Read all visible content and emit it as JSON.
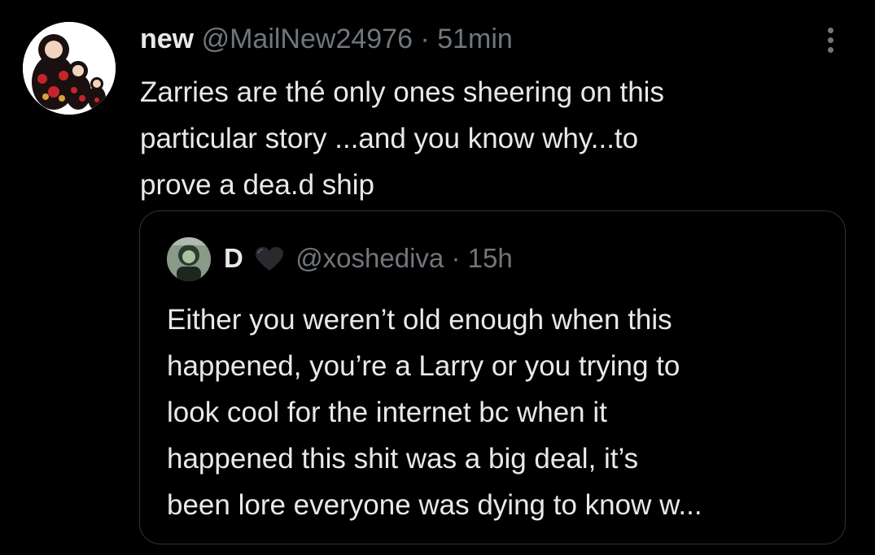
{
  "tweet": {
    "display_name": "new",
    "handle": "@MailNew24976",
    "separator": "·",
    "time": "51min",
    "text": "Zarries are thé only ones sheering on this\nparticular story ...and you know why...to\nprove a dea.d ship",
    "avatar_icon": "matryoshka-dolls-avatar",
    "more_icon": "more-options-icon"
  },
  "quote": {
    "display_name": "D",
    "emoji": "black-heart-icon",
    "handle": "@xoshediva",
    "separator": "·",
    "time": "15h",
    "text": "Either you weren’t old enough when this\nhappened, you’re a Larry or you trying to\nlook cool for the internet bc when it\nhappened this shit was a big deal, it’s\nbeen lore everyone was dying to know w..."
  },
  "colors": {
    "background": "#000000",
    "text_primary": "#e7e9ea",
    "text_secondary": "#71767b",
    "border": "#2f3336"
  }
}
